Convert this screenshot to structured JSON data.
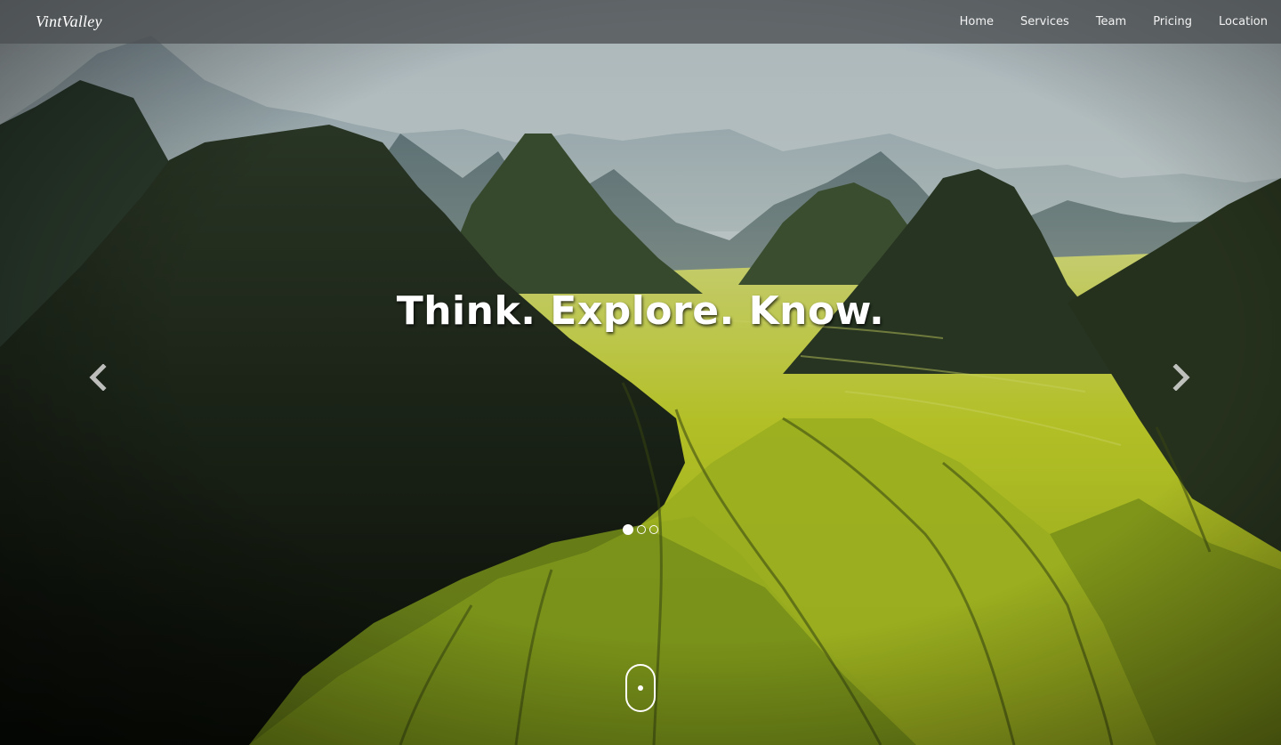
{
  "navbar": {
    "brand": "VintValley",
    "links": [
      "Home",
      "Services",
      "Team",
      "Pricing",
      "Location"
    ]
  },
  "hero": {
    "caption": "Think. Explore. Know.",
    "slides_count": 3,
    "active_slide": 1
  },
  "icons": {
    "prev": "chevron-left-icon",
    "next": "chevron-right-icon",
    "scroll": "mouse-scroll-icon"
  },
  "colors": {
    "navbar_bg": "#4b5052",
    "text": "#ffffff",
    "field_yellow": "#c6d21a",
    "mountain_dark": "#1e2a17",
    "sky": "#c9d6dc"
  }
}
